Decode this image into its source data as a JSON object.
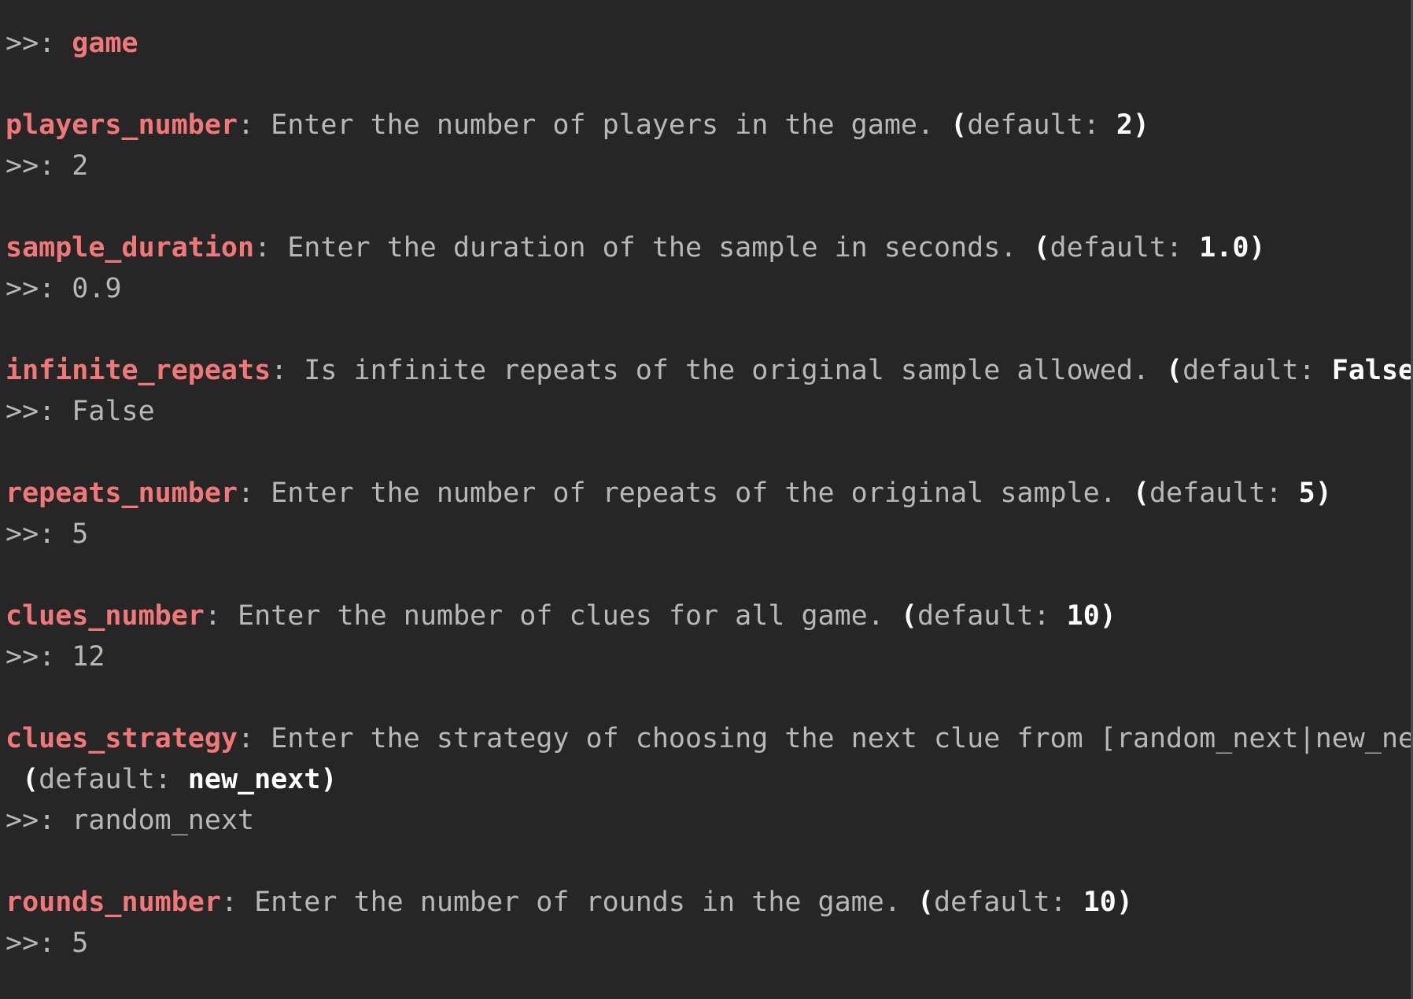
{
  "terminal": {
    "prompt": ">>: ",
    "command": "game",
    "default_label": "default: ",
    "colors": {
      "background": "#262626",
      "param": "#f07878",
      "text": "#b8b8b8",
      "highlight": "#ffffff"
    },
    "entries": [
      {
        "param": "players_number",
        "description": " Enter the number of players in the game. ",
        "default": "2",
        "answer": "2"
      },
      {
        "param": "sample_duration",
        "description": " Enter the duration of the sample in seconds. ",
        "default": "1.0",
        "answer": "0.9"
      },
      {
        "param": "infinite_repeats",
        "description": " Is infinite repeats of the original sample allowed. ",
        "default": "False",
        "answer": "False"
      },
      {
        "param": "repeats_number",
        "description": " Enter the number of repeats of the original sample. ",
        "default": "5",
        "answer": "5"
      },
      {
        "param": "clues_number",
        "description": " Enter the number of clues for all game. ",
        "default": "10",
        "answer": "12"
      },
      {
        "param": "clues_strategy",
        "description": " Enter the strategy of choosing the next clue from [random_next|new_next].",
        "wrap_prefix": " ",
        "default": "new_next",
        "answer": "random_next"
      },
      {
        "param": "rounds_number",
        "description": " Enter the number of rounds in the game. ",
        "default": "10",
        "answer": "5"
      }
    ]
  }
}
